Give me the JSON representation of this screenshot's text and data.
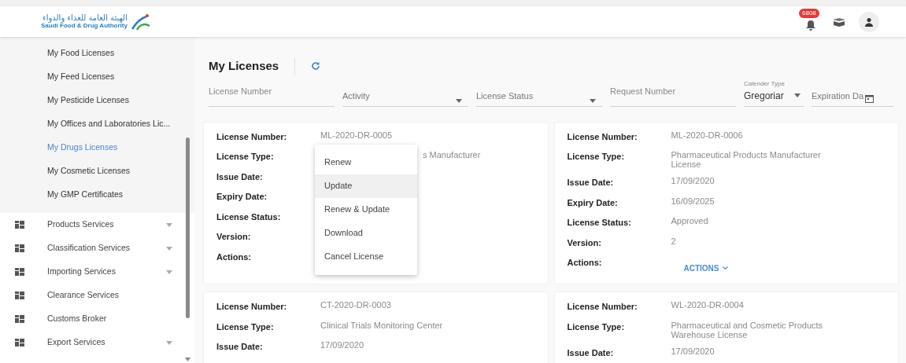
{
  "header": {
    "logo_arabic": "الهيئة العامة للغذاء والدواء",
    "logo_english": "Saudi Food & Drug Authority",
    "notification_count": "6808"
  },
  "sidebar": {
    "submenu": [
      {
        "label": "My Food Licenses",
        "selected": false
      },
      {
        "label": "My Feed Licenses",
        "selected": false
      },
      {
        "label": "My Pesticide Licenses",
        "selected": false
      },
      {
        "label": "My Offices and Laboratories Lic...",
        "selected": false
      },
      {
        "label": "My Drugs Licenses",
        "selected": true
      },
      {
        "label": "My Cosmetic Licenses",
        "selected": false
      },
      {
        "label": "My GMP Certificates",
        "selected": false
      }
    ],
    "items": [
      {
        "label": "Products Services",
        "expandable": true
      },
      {
        "label": "Classification Services",
        "expandable": true
      },
      {
        "label": "Importing Services",
        "expandable": true
      },
      {
        "label": "Clearance Services",
        "expandable": false
      },
      {
        "label": "Customs Broker",
        "expandable": false
      },
      {
        "label": "Export Services",
        "expandable": true
      }
    ]
  },
  "page_title": "My Licenses",
  "filters": [
    {
      "kind": "text",
      "placeholder": "License Number"
    },
    {
      "kind": "select",
      "placeholder": "Activity"
    },
    {
      "kind": "select",
      "placeholder": "License Status"
    },
    {
      "kind": "text",
      "placeholder": "Request Number"
    },
    {
      "kind": "labeled-select",
      "label": "Calender Type",
      "value": "Gregoriar"
    },
    {
      "kind": "date",
      "placeholder": "Expiration Da"
    }
  ],
  "cards": [
    {
      "rows": [
        {
          "label": "License Number:",
          "value": "ML-2020-DR-0005"
        },
        {
          "label": "License Type:",
          "value": "s Manufacturer",
          "kind": "covered"
        },
        {
          "label": "Issue Date:"
        },
        {
          "label": "Expiry Date:"
        },
        {
          "label": "License Status:"
        },
        {
          "label": "Version:"
        },
        {
          "label": "Actions:"
        }
      ],
      "menu": [
        {
          "label": "Renew",
          "selected": false
        },
        {
          "label": "Update",
          "selected": true
        },
        {
          "label": "Renew & Update",
          "selected": false
        },
        {
          "label": "Download",
          "selected": false
        },
        {
          "label": "Cancel License",
          "selected": false
        }
      ]
    },
    {
      "rows": [
        {
          "label": "License Number:",
          "value": "ML-2020-DR-0006"
        },
        {
          "label": "License Type:",
          "value": "Pharmaceutical Products Manufacturer License"
        },
        {
          "label": "Issue Date:",
          "value": "17/09/2020"
        },
        {
          "label": "Expiry Date:",
          "value": "16/09/2025"
        },
        {
          "label": "License Status:",
          "value": "Approved"
        },
        {
          "label": "Version:",
          "value": "2"
        },
        {
          "label": "Actions:",
          "kind": "actions",
          "value": "ACTIONS"
        }
      ]
    },
    {
      "rows": [
        {
          "label": "License Number:",
          "value": "CT-2020-DR-0003"
        },
        {
          "label": "License Type:",
          "value": "Clinical Trials Monitoring Center"
        },
        {
          "label": "Issue Date:",
          "value": "17/09/2020"
        }
      ]
    },
    {
      "rows": [
        {
          "label": "License Number:",
          "value": "WL-2020-DR-0004"
        },
        {
          "label": "License Type:",
          "value": "Pharmaceutical and Cosmetic Products Warehouse License"
        },
        {
          "label": "Issue Date:",
          "value": "17/09/2020"
        }
      ]
    }
  ]
}
